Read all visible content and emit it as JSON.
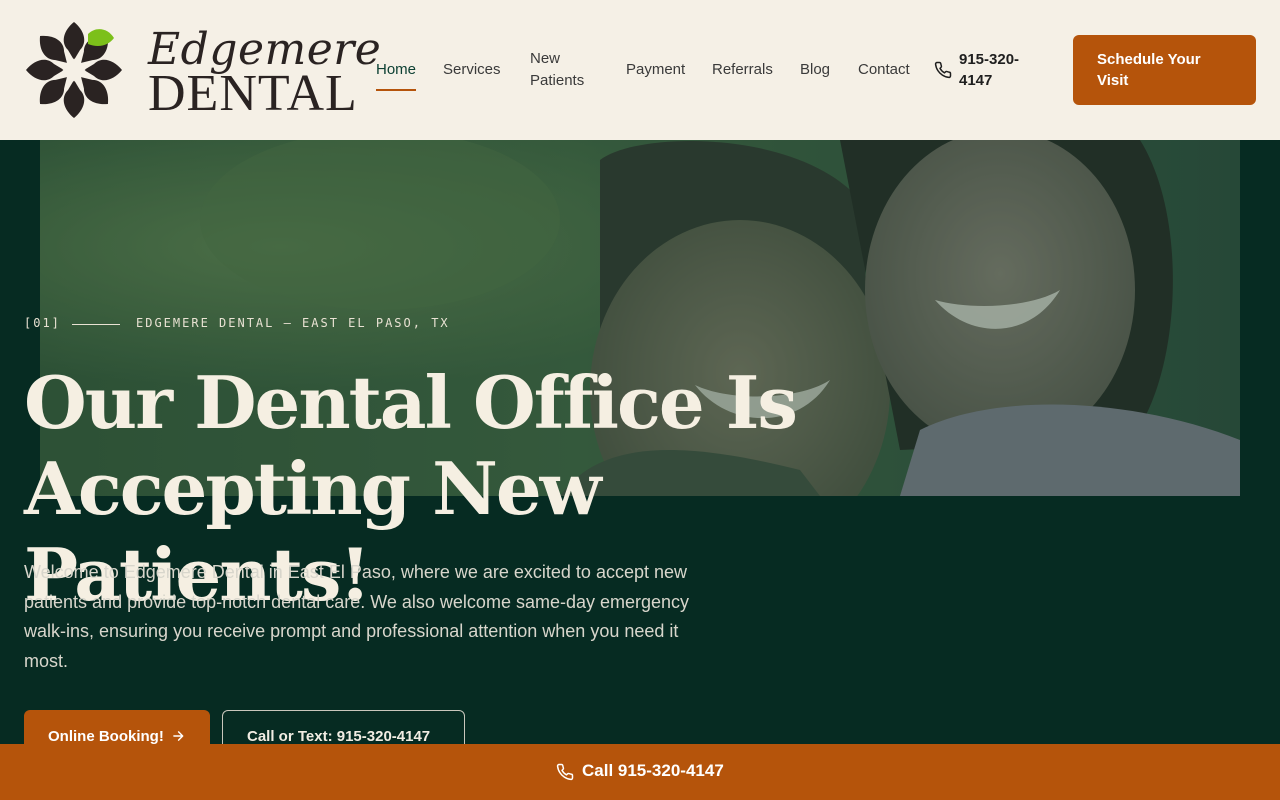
{
  "brand": {
    "name": "Edgemere",
    "sub": "DENTAL",
    "colors": {
      "cream": "#f5f0e6",
      "forest": "#062b22",
      "accent": "#b5540b",
      "leaf": "#7cc01a"
    }
  },
  "nav": {
    "items": [
      {
        "label": "Home",
        "active": true
      },
      {
        "label": "Services"
      },
      {
        "label": "New Patients"
      },
      {
        "label": "Payment"
      },
      {
        "label": "Referrals"
      },
      {
        "label": "Blog"
      },
      {
        "label": "Contact"
      }
    ],
    "phone": "915-320-4147",
    "phone_icon": "phone-icon",
    "cta": "Schedule Your Visit"
  },
  "hero": {
    "eyebrow_num": "[01]",
    "eyebrow_text": "EDGEMERE DENTAL — EAST EL PASO, TX",
    "headline": "Our Dental Office Is Accepting New Patients!",
    "lede": "Welcome to Edgemere Dental in East El Paso, where we are excited to accept new patients and provide top-notch dental care. We also welcome same-day emergency walk-ins, ensuring you receive prompt and professional attention when you need it most.",
    "primary_button": "Online Booking!",
    "primary_icon": "arrow-right-icon",
    "secondary_button": "Call or Text: 915-320-4147",
    "photo_icon": "smiling-couple-photo"
  },
  "callbar": {
    "label": "Call 915-320-4147",
    "icon": "phone-icon"
  }
}
